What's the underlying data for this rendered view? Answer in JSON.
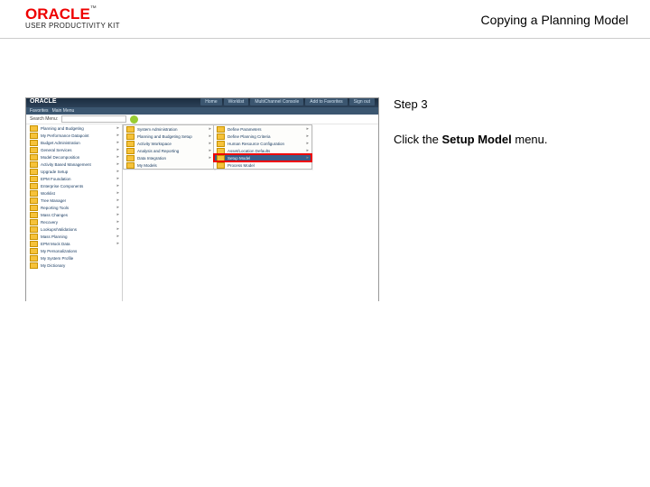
{
  "banner": {
    "logo_word": "ORACLE",
    "logo_tm": "™",
    "logo_sub": "USER PRODUCTIVITY KIT",
    "title": "Copying a Planning Model"
  },
  "instruction": {
    "step_label": "Step 3",
    "body_prefix": "Click the ",
    "body_bold": "Setup Model",
    "body_suffix": " menu."
  },
  "shot": {
    "mini_logo": "ORACLE",
    "nav": [
      "Home",
      "Worklist",
      "MultiChannel Console",
      "Add to Favorites",
      "Sign out"
    ],
    "menubar": [
      "Favorites",
      "Main Menu"
    ],
    "crumb": {
      "label": "Search Menu:"
    },
    "tree": [
      "Planning and Budgeting",
      "My Performance Datapoint",
      "Budget Administration",
      "General Services",
      "Model Decomposition",
      "Activity Based Management",
      "Upgrade Setup",
      "EPM Foundation",
      "Enterprise Components",
      "Worklist",
      "Tree Manager",
      "Reporting Tools",
      "Mass Changes",
      "Recovery",
      "Lookups/Validations",
      "Mass Planning",
      "EPM Mock Data",
      "My Personalizations",
      "My System Profile",
      "My Dictionary"
    ],
    "fly1": [
      "System Administration",
      "Planning and Budgeting Setup",
      "Activity Workspace",
      "Analysis and Reporting",
      "Data Integration",
      "My Models"
    ],
    "fly2": [
      "Define Parameters",
      "Define Planning Criteria",
      "Human Resource Configuration",
      "Asset/Location Defaults",
      "Setup Model",
      "Process Model"
    ]
  }
}
